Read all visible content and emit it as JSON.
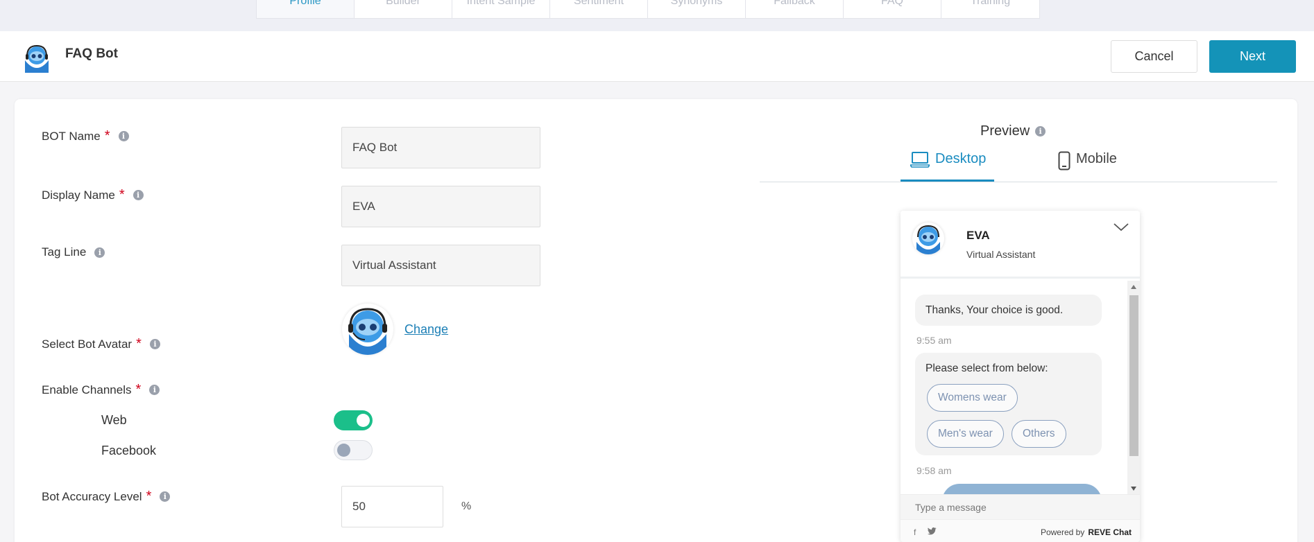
{
  "top_tabs": [
    "Profile",
    "Builder",
    "Intent Sample",
    "Sentiment",
    "Synonyms",
    "Fallback",
    "FAQ",
    "Training"
  ],
  "header": {
    "title": "FAQ Bot",
    "cancel_label": "Cancel",
    "next_label": "Next"
  },
  "form": {
    "bot_name": {
      "label": "BOT Name",
      "value": "FAQ Bot"
    },
    "display_name": {
      "label": "Display Name",
      "value": "EVA"
    },
    "tag_line": {
      "label": "Tag Line",
      "value": "Virtual Assistant"
    },
    "avatar": {
      "label": "Select Bot Avatar",
      "change_label": "Change"
    },
    "channels": {
      "label": "Enable Channels",
      "web_label": "Web",
      "web_enabled": true,
      "facebook_label": "Facebook",
      "facebook_enabled": false
    },
    "accuracy": {
      "label": "Bot Accuracy Level",
      "value": "50",
      "unit": "%"
    },
    "required_mark": "*",
    "info_glyph": "i"
  },
  "preview": {
    "title": "Preview",
    "tabs": {
      "desktop": "Desktop",
      "mobile": "Mobile"
    },
    "chat": {
      "name": "EVA",
      "tagline": "Virtual Assistant",
      "msg1": "Thanks, Your choice is good.",
      "time1": "9:55 am",
      "msg2": "Please select from below:",
      "chips": [
        "Womens wear",
        "Men's wear",
        "Others"
      ],
      "time2": "9:58 am",
      "input_placeholder": "Type a message",
      "social_fb": "f",
      "powered_by": "Powered by",
      "brand": "REVE Chat"
    }
  },
  "colors": {
    "accent": "#1493b8",
    "toggle_on": "#1bbf8a",
    "link": "#1c7fb6",
    "required": "#d0021b"
  }
}
